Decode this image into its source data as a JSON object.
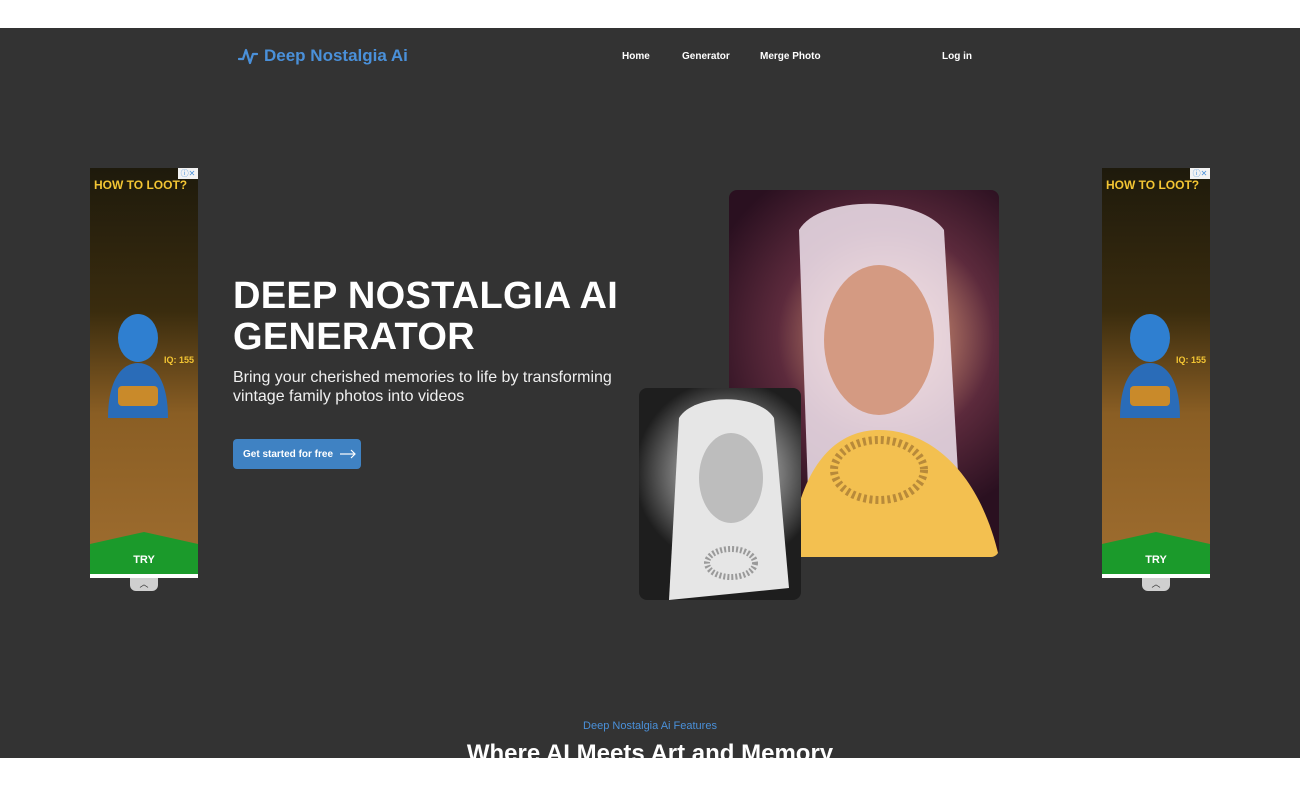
{
  "header": {
    "brand": "Deep Nostalgia Ai",
    "brand_icon": "wave-pulse-icon",
    "nav": [
      {
        "label": "Home"
      },
      {
        "label": "Generator"
      },
      {
        "label": "Merge Photo"
      }
    ],
    "login": "Log in"
  },
  "hero": {
    "title": "DEEP NOSTALGIA AI GENERATOR",
    "subtitle": "Bring your cherished memories to life by transforming vintage family photos into videos",
    "cta_label": "Get started for free",
    "cta_icon": "arrow-right-icon"
  },
  "ads": {
    "left": {
      "headline": "HOW TO LOOT?",
      "iq": "IQ: 155",
      "cta": "TRY"
    },
    "right": {
      "headline": "HOW TO LOOT?",
      "iq": "IQ: 155",
      "cta": "TRY"
    }
  },
  "features": {
    "eyebrow": "Deep Nostalgia Ai Features",
    "title": "Where AI Meets Art and Memory"
  },
  "colors": {
    "accent": "#4a90d9",
    "background": "#333333",
    "button": "#3f82c3"
  }
}
